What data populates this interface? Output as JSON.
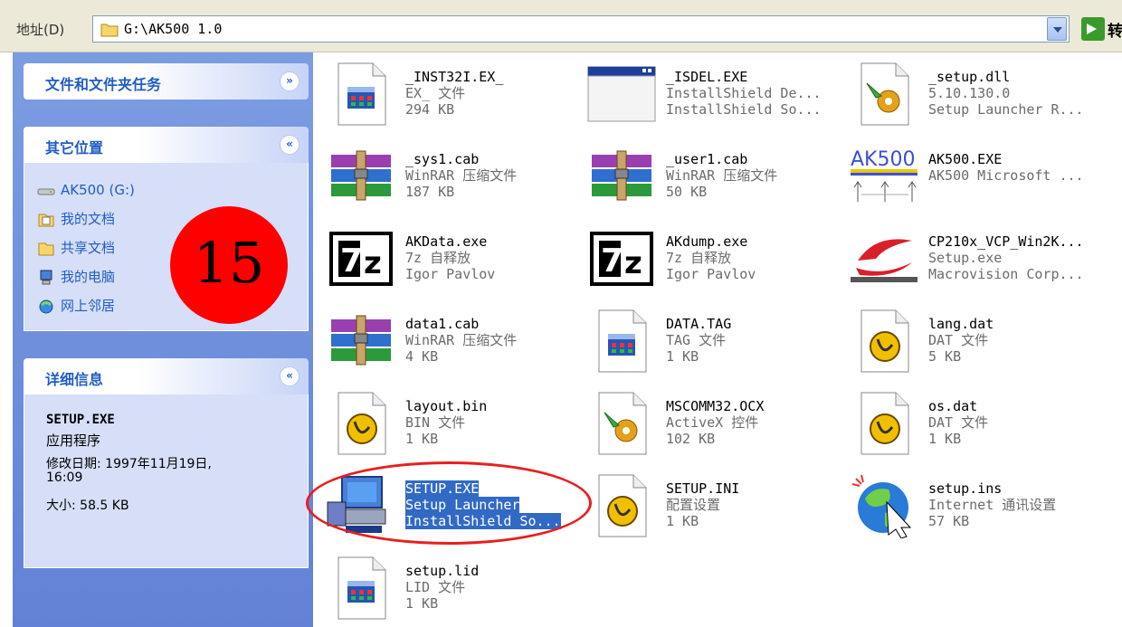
{
  "address": {
    "label": "地址(D)",
    "value": "G:\\AK500 1.0"
  },
  "go_label": "转",
  "tasks": {
    "file_tasks": {
      "title": "文件和文件夹任务",
      "chevron": "»"
    },
    "other_places": {
      "title": "其它位置",
      "chevron": "«",
      "items": [
        {
          "label": "AK500 (G:)",
          "icon": "drive-icon"
        },
        {
          "label": "我的文档",
          "icon": "my-documents-icon"
        },
        {
          "label": "共享文档",
          "icon": "shared-folder-icon"
        },
        {
          "label": "我的电脑",
          "icon": "my-computer-icon"
        },
        {
          "label": "网上邻居",
          "icon": "network-places-icon"
        }
      ]
    },
    "details": {
      "title": "详细信息",
      "chevron": "«",
      "name": "SETUP.EXE",
      "type": "应用程序",
      "modified": "修改日期: 1997年11月19日,",
      "time": "16:09",
      "size": "大小: 58.5 KB"
    }
  },
  "badge": "15",
  "files": [
    {
      "name": "_INST32I.EX_",
      "line2": "EX_ 文件",
      "line3": "294 KB",
      "icon": "generic-file-icon"
    },
    {
      "name": "_ISDEL.EXE",
      "line2": "InstallShield De...",
      "line3": "InstallShield So...",
      "icon": "app-window-icon"
    },
    {
      "name": "_setup.dll",
      "line2": "5.10.130.0",
      "line3": "Setup Launcher R...",
      "icon": "dll-gear-icon"
    },
    {
      "name": "_sys1.cab",
      "line2": "WinRAR 压缩文件",
      "line3": "187 KB",
      "icon": "winrar-icon"
    },
    {
      "name": "_user1.cab",
      "line2": "WinRAR 压缩文件",
      "line3": "50 KB",
      "icon": "winrar-icon"
    },
    {
      "name": "AK500.EXE",
      "line2": "AK500 Microsoft ...",
      "line3": "",
      "icon": "ak500-logo-icon",
      "logo_text": "AK500"
    },
    {
      "name": "AKData.exe",
      "line2": "7z 自释放",
      "line3": "Igor Pavlov",
      "icon": "7z-icon",
      "logo_text": "7z"
    },
    {
      "name": "AKdump.exe",
      "line2": "7z 自释放",
      "line3": "Igor Pavlov",
      "icon": "7z-icon",
      "logo_text": "7z"
    },
    {
      "name": "CP210x_VCP_Win2K...",
      "line2": "Setup.exe",
      "line3": "Macrovision Corp...",
      "icon": "silicon-labs-icon"
    },
    {
      "name": "data1.cab",
      "line2": "WinRAR 压缩文件",
      "line3": "4 KB",
      "icon": "winrar-icon"
    },
    {
      "name": "DATA.TAG",
      "line2": "TAG 文件",
      "line3": "1 KB",
      "icon": "generic-file-icon"
    },
    {
      "name": "lang.dat",
      "line2": "DAT 文件",
      "line3": "5 KB",
      "icon": "dat-file-icon"
    },
    {
      "name": "layout.bin",
      "line2": "BIN 文件",
      "line3": "1 KB",
      "icon": "dat-file-icon"
    },
    {
      "name": "MSCOMM32.OCX",
      "line2": "ActiveX 控件",
      "line3": "102 KB",
      "icon": "dll-gear-icon"
    },
    {
      "name": "os.dat",
      "line2": "DAT 文件",
      "line3": "1 KB",
      "icon": "dat-file-icon"
    },
    {
      "name": "SETUP.EXE",
      "line2": "Setup Launcher",
      "line3": "InstallShield So...",
      "icon": "setup-computer-icon",
      "selected": true
    },
    {
      "name": "SETUP.INI",
      "line2": "配置设置",
      "line3": "1 KB",
      "icon": "dat-file-icon"
    },
    {
      "name": "setup.ins",
      "line2": "Internet 通讯设置",
      "line3": "57 KB",
      "icon": "internet-globe-icon"
    },
    {
      "name": "setup.lid",
      "line2": "LID 文件",
      "line3": "1 KB",
      "icon": "generic-file-icon"
    }
  ]
}
